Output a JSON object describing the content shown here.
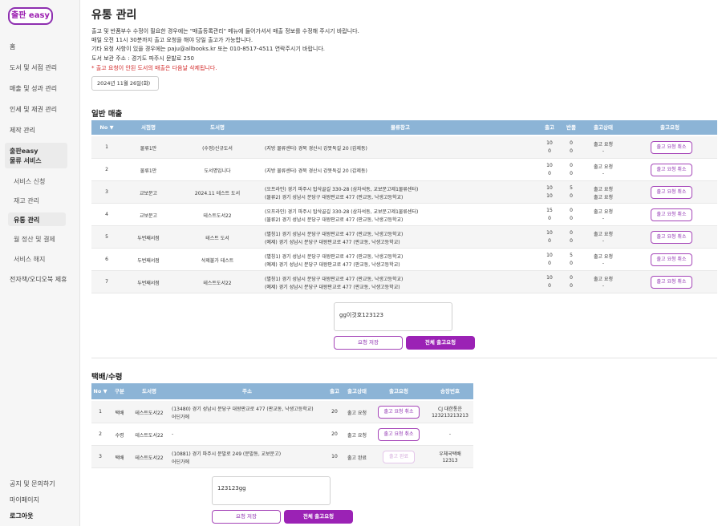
{
  "logo": "출판 easy",
  "sidebar": {
    "items": [
      "홈",
      "도서 및 서점 관리",
      "매출 및 성과 관리",
      "인세 및 재권 관리",
      "제작 관리"
    ],
    "group_line1": "출판easy",
    "group_line2": "물류 서비스",
    "sub_items": [
      "서비스 신청",
      "재고 관리",
      "유통 관리",
      "월 정산 및 결제",
      "서비스 해지"
    ],
    "extra": "전자책/오디오북 제휴",
    "bottom": [
      "공지 및 문의하기",
      "마이페이지",
      "로그아웃"
    ]
  },
  "page": {
    "title": "유통 관리",
    "notices": [
      "출고 및 반품부수 수정이 필요한 경우에는 \"매출등록관리\" 메뉴에 들어가셔서 매출 정보를 수정해 주시기 바랍니다.",
      "매일 오전 11시 30분까지 출고 요청을 해야 당일 출고가 가능합니다.",
      "기타 요청 사항이 있을 경우에는 paju@allbooks.kr 또는 010-8517-4511 연락주시기 바랍니다.",
      "도서 보관 주소 : 경기도 파주시 문발로 250"
    ],
    "red_notice": "* 출고 요청이 안된 도서의 매출은 다음날 삭제됩니다.",
    "date": "2024년 11월 26일(화)"
  },
  "sales": {
    "title": "일반 매출",
    "headers": [
      "No ▼",
      "서점명",
      "도서명",
      "물류창고",
      "출고",
      "반품",
      "출고상태",
      "출고요청"
    ],
    "rows": [
      {
        "no": "1",
        "store": "물류1만",
        "book": "(수정)신규도서",
        "w1": "(지방 물류센터) 경북 경산시 강못둑길 20 (갑제동)",
        "w2": "",
        "out1": "10",
        "out2": "0",
        "ret1": "0",
        "ret2": "0",
        "st1": "출고 요청",
        "st2": "-",
        "btn": "출고 요청 취소"
      },
      {
        "no": "2",
        "store": "물류1만",
        "book": "도서명입니다",
        "w1": "(지방 물류센터) 경북 경산시 강못둑길 20 (갑제동)",
        "w2": "",
        "out1": "10",
        "out2": "0",
        "ret1": "0",
        "ret2": "0",
        "st1": "출고 요청",
        "st2": "-",
        "btn": "출고 요청 취소"
      },
      {
        "no": "3",
        "store": "교보문고",
        "book": "2024.11 테스트 도서",
        "w1": "(오프라인) 경기 파주시 탑삭골길 330-28 (삼차석동, 교보문고제1물류센터)",
        "w2": "(물류2) 경기 성남시 분당구 대왕판교로 477 (판교동, 낙생고등학교)",
        "out1": "10",
        "out2": "10",
        "ret1": "5",
        "ret2": "0",
        "st1": "출고 요청",
        "st2": "출고 요청",
        "btn": "출고 요청 취소"
      },
      {
        "no": "4",
        "store": "교보문고",
        "book": "테스트도서22",
        "w1": "(오프라인) 경기 파주시 탑삭골길 330-28 (삼차석동, 교보문고제1물류센터)",
        "w2": "(물류2) 경기 성남시 분당구 대왕판교로 477 (판교동, 낙생고등학교)",
        "out1": "15",
        "out2": "0",
        "ret1": "0",
        "ret2": "0",
        "st1": "출고 요청",
        "st2": "-",
        "btn": "출고 요청 취소"
      },
      {
        "no": "5",
        "store": "두번째서점",
        "book": "테스트 도서",
        "w1": "(별칭1) 경기 성남시 분당구 대왕판교로 477 (판교동, 낙생고등학교)",
        "w2": "(예제) 경기 성남시 분당구 대왕판교로 477 (판교동, 낙생고등학교)",
        "out1": "10",
        "out2": "0",
        "ret1": "0",
        "ret2": "0",
        "st1": "출고 요청",
        "st2": "-",
        "btn": "출고 요청 취소"
      },
      {
        "no": "6",
        "store": "두번째서점",
        "book": "삭제불가 테스트",
        "w1": "(별칭1) 경기 성남시 분당구 대왕판교로 477 (판교동, 낙생고등학교)",
        "w2": "(예제) 경기 성남시 분당구 대왕판교로 477 (판교동, 낙생고등학교)",
        "out1": "10",
        "out2": "0",
        "ret1": "5",
        "ret2": "0",
        "st1": "출고 요청",
        "st2": "-",
        "btn": "출고 요청 취소"
      },
      {
        "no": "7",
        "store": "두번째서점",
        "book": "테스트도서22",
        "w1": "(별칭1) 경기 성남시 분당구 대왕판교로 477 (판교동, 낙생고등학교)",
        "w2": "(예제) 경기 성남시 분당구 대왕판교로 477 (판교동, 낙생고등학교)",
        "out1": "10",
        "out2": "0",
        "ret1": "0",
        "ret2": "0",
        "st1": "출고 요청",
        "st2": "-",
        "btn": "출고 요청 취소"
      }
    ],
    "memo": "gg이것호123123",
    "save_label": "요청 저장",
    "all_label": "전체 출고요청"
  },
  "delivery": {
    "title": "택배/수령",
    "headers": [
      "No ▼",
      "구분",
      "도서명",
      "주소",
      "출고",
      "출고상태",
      "출고요청",
      "송장번호"
    ],
    "rows": [
      {
        "no": "1",
        "type": "택배",
        "book": "테스트도서22",
        "a1": "(13480) 경기 성남시 분당구 대왕판교로 477 (판교동, 낙생고등학교)",
        "a2": "어딘가에",
        "out": "20",
        "st": "출고 요청",
        "btn": "출고 요청 취소",
        "inv1": "CJ 대한통운",
        "inv2": "123213213213"
      },
      {
        "no": "2",
        "type": "수령",
        "book": "테스트도서22",
        "a1": "-",
        "a2": "",
        "out": "20",
        "st": "출고 요청",
        "btn": "출고 요청 취소",
        "inv1": "-",
        "inv2": ""
      },
      {
        "no": "3",
        "type": "택배",
        "book": "테스트도서22",
        "a1": "(10881) 경기 파주시 문발로 249 (문발동, 교보문고)",
        "a2": "어딘가에",
        "out": "10",
        "st": "출고 완료",
        "btn": "출고 완료",
        "inv1": "우체국택배",
        "inv2": "12313"
      }
    ],
    "memo": "123123gg",
    "save_label": "요청 저장",
    "all_label": "전체 출고요청"
  },
  "colors": {
    "accent": "#9b22b5",
    "header": "#8cb4d6",
    "red": "#d32b2b"
  }
}
